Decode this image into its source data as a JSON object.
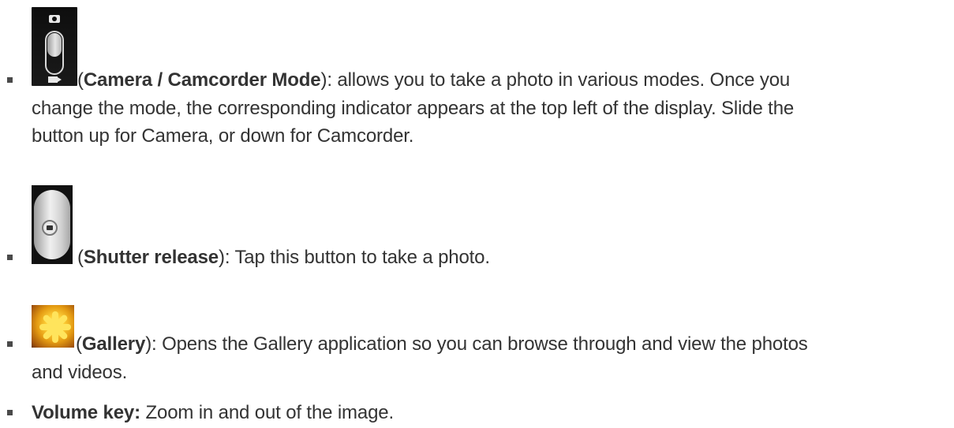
{
  "items": [
    {
      "icon": "camera-camcorder-mode-switch-icon",
      "lines": [
        {
          "open": "(",
          "bold": "Camera / Camcorder Mode",
          "rest": "): allows you to take a photo in various modes. Once you"
        },
        {
          "text": "change the mode, the corresponding indicator appears at the top left of the display. Slide the"
        },
        {
          "text": "button up for Camera, or down for Camcorder."
        }
      ]
    },
    {
      "icon": "shutter-release-icon",
      "lines": [
        {
          "open": "(",
          "bold": "Shutter release",
          "rest": "): Tap this button to take a photo."
        }
      ]
    },
    {
      "icon": "gallery-thumbnail-icon",
      "lines": [
        {
          "open": "(",
          "bold": "Gallery",
          "rest": "): Opens the Gallery application so you can browse through and view the photos"
        },
        {
          "text": "and videos."
        }
      ]
    },
    {
      "lines": [
        {
          "bold": "Volume key:",
          "rest": " Zoom in and out of the image."
        }
      ]
    }
  ]
}
